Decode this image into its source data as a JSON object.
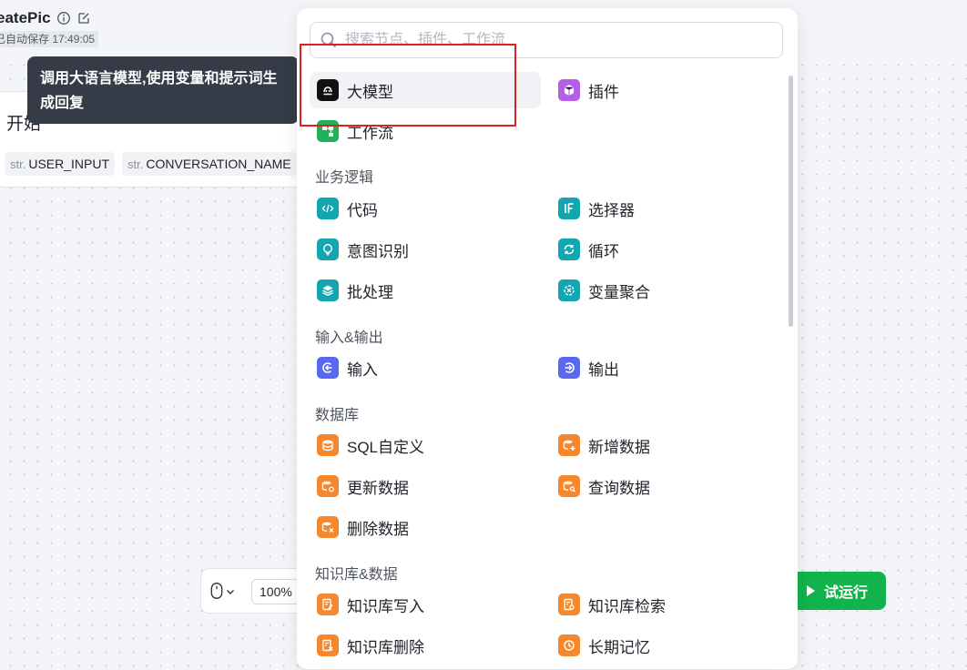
{
  "header": {
    "title": "eatePic",
    "autosave": "已自动保存 17:49:05"
  },
  "start_node": {
    "title": "开始",
    "variables": [
      {
        "type": "str.",
        "name": "USER_INPUT"
      },
      {
        "type": "str.",
        "name": "CONVERSATION_NAME"
      }
    ]
  },
  "tooltip": {
    "text": "调用大语言模型,使用变量和提示词生成回复"
  },
  "toolbar": {
    "zoom": "100%",
    "run_label": "试运行"
  },
  "panel": {
    "search_placeholder": "搜索节点、插件、工作流",
    "top_items": [
      {
        "label": "大模型",
        "icon": "llm-icon",
        "color": "#111111"
      },
      {
        "label": "插件",
        "icon": "plugin-icon",
        "color": "#b45fe5"
      },
      {
        "label": "工作流",
        "icon": "workflow-icon",
        "color": "#20b25a"
      }
    ],
    "sections": [
      {
        "title": "业务逻辑",
        "items": [
          {
            "label": "代码",
            "icon": "code-icon",
            "color": "#12a6b1"
          },
          {
            "label": "选择器",
            "icon": "if-icon",
            "color": "#12a6b1"
          },
          {
            "label": "意图识别",
            "icon": "intent-icon",
            "color": "#12a6b1"
          },
          {
            "label": "循环",
            "icon": "loop-icon",
            "color": "#12a6b1"
          },
          {
            "label": "批处理",
            "icon": "batch-icon",
            "color": "#12a6b1"
          },
          {
            "label": "变量聚合",
            "icon": "aggregate-icon",
            "color": "#12a6b1"
          }
        ]
      },
      {
        "title": "输入&输出",
        "items": [
          {
            "label": "输入",
            "icon": "input-icon",
            "color": "#5a67ef"
          },
          {
            "label": "输出",
            "icon": "output-icon",
            "color": "#5a67ef"
          }
        ]
      },
      {
        "title": "数据库",
        "items": [
          {
            "label": "SQL自定义",
            "icon": "database-icon",
            "color": "#f5872d"
          },
          {
            "label": "新增数据",
            "icon": "database-add-icon",
            "color": "#f5872d"
          },
          {
            "label": "更新数据",
            "icon": "database-update-icon",
            "color": "#f5872d"
          },
          {
            "label": "查询数据",
            "icon": "database-query-icon",
            "color": "#f5872d"
          },
          {
            "label": "删除数据",
            "icon": "database-delete-icon",
            "color": "#f5872d"
          }
        ]
      },
      {
        "title": "知识库&数据",
        "items": [
          {
            "label": "知识库写入",
            "icon": "knowledge-write-icon",
            "color": "#f5872d"
          },
          {
            "label": "知识库检索",
            "icon": "knowledge-search-icon",
            "color": "#f5872d"
          },
          {
            "label": "知识库删除",
            "icon": "knowledge-delete-icon",
            "color": "#f5872d"
          },
          {
            "label": "长期记忆",
            "icon": "memory-icon",
            "color": "#f5872d"
          }
        ]
      }
    ]
  }
}
